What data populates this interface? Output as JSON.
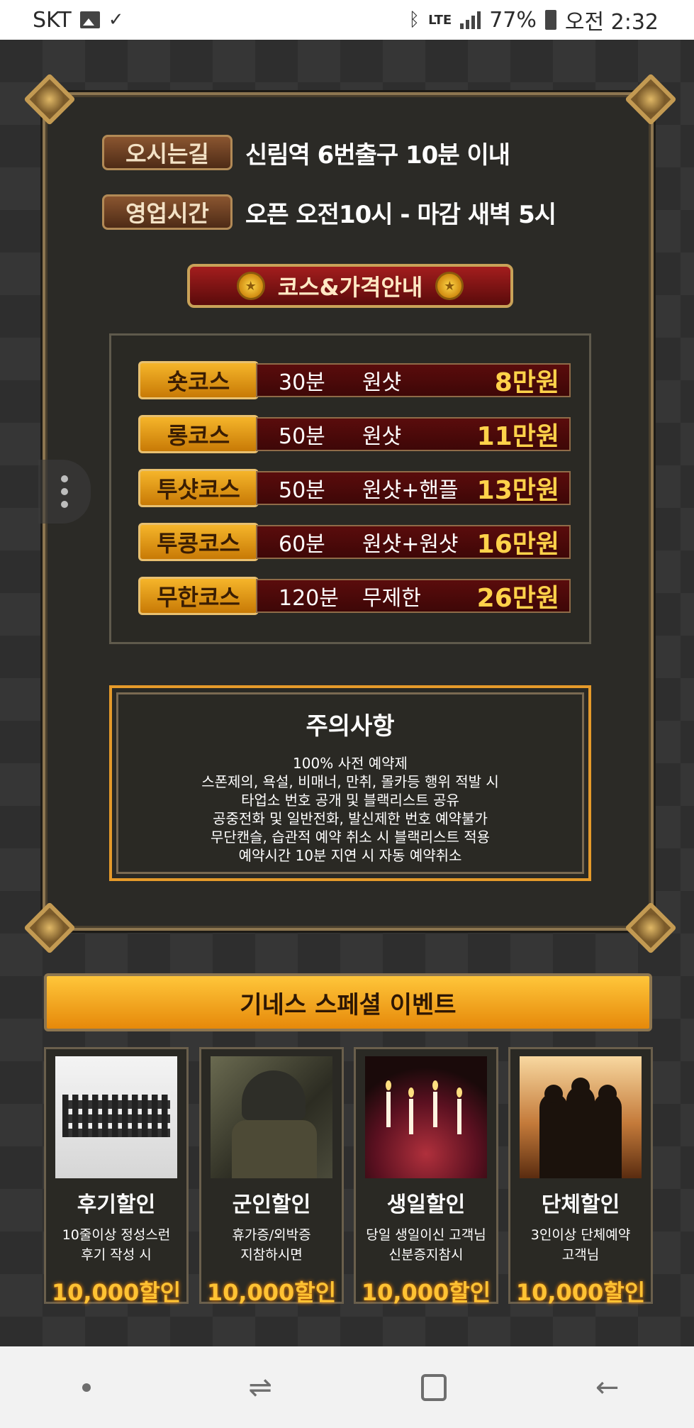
{
  "status_bar": {
    "carrier": "SKT",
    "network": "LTE",
    "battery": "77%",
    "time": "오전 2:32"
  },
  "info": {
    "directions_label": "오시는길",
    "directions_text": "신림역 6번출구 10분 이내",
    "hours_label": "영업시간",
    "hours_text": "오픈 오전10시 - 마감 새벽 5시"
  },
  "course_banner": "코스&가격안내",
  "courses": [
    {
      "name": "숏코스",
      "time": "30분",
      "desc": "원샷",
      "price": "8만원"
    },
    {
      "name": "롱코스",
      "time": "50분",
      "desc": "원샷",
      "price": "11만원"
    },
    {
      "name": "투샷코스",
      "time": "50분",
      "desc": "원샷+핸플",
      "price": "13만원"
    },
    {
      "name": "투콩코스",
      "time": "60분",
      "desc": "원샷+원샷",
      "price": "16만원"
    },
    {
      "name": "무한코스",
      "time": "120분",
      "desc": "무제한",
      "price": "26만원"
    }
  ],
  "notice": {
    "title": "주의사항",
    "lines": [
      "100% 사전 예약제",
      "스폰제의, 욕설, 비매너, 만취, 몰카등 행위 적발 시",
      "타업소 번호 공개 및 블랙리스트 공유",
      "공중전화 및 일반전화, 발신제한 번호 예약불가",
      "무단캔슬, 습관적 예약 취소 시 블랙리스트 적용",
      "예약시간 10분 지연 시 자동 예약취소"
    ]
  },
  "event_banner": "기네스 스페셜 이벤트",
  "events": [
    {
      "title": "후기할인",
      "desc1": "10줄이상 정성스런",
      "desc2": "후기 작성 시",
      "discount": "10,000할인"
    },
    {
      "title": "군인할인",
      "desc1": "휴가증/외박증",
      "desc2": "지참하시면",
      "discount": "10,000할인"
    },
    {
      "title": "생일할인",
      "desc1": "당일 생일이신 고객님",
      "desc2": "신분증지참시",
      "discount": "10,000할인"
    },
    {
      "title": "단체할인",
      "desc1": "3인이상 단체예약",
      "desc2": "고객님",
      "discount": "10,000할인"
    }
  ],
  "colors": {
    "accent_gold": "#ffc233",
    "price_gold": "#ffd24a",
    "panel_border": "#8d7650",
    "banner_red": "#a31d1d"
  }
}
